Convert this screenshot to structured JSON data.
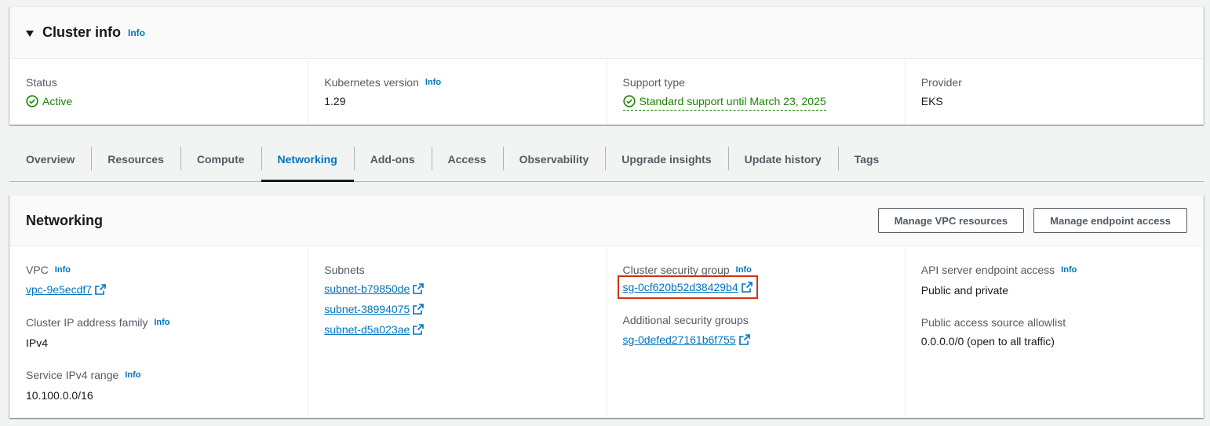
{
  "cluster_info": {
    "title": "Cluster info",
    "info": "Info",
    "status": {
      "label": "Status",
      "value": "Active"
    },
    "kubernetes_version": {
      "label": "Kubernetes version",
      "info": "Info",
      "value": "1.29"
    },
    "support_type": {
      "label": "Support type",
      "value": "Standard support until March 23, 2025"
    },
    "provider": {
      "label": "Provider",
      "value": "EKS"
    }
  },
  "tabs": [
    {
      "label": "Overview"
    },
    {
      "label": "Resources"
    },
    {
      "label": "Compute"
    },
    {
      "label": "Networking",
      "active": true
    },
    {
      "label": "Add-ons"
    },
    {
      "label": "Access"
    },
    {
      "label": "Observability"
    },
    {
      "label": "Upgrade insights"
    },
    {
      "label": "Update history"
    },
    {
      "label": "Tags"
    }
  ],
  "networking": {
    "title": "Networking",
    "buttons": {
      "manage_vpc": "Manage VPC resources",
      "manage_endpoint": "Manage endpoint access"
    },
    "vpc": {
      "label": "VPC",
      "info": "Info",
      "value": "vpc-9e5ecdf7"
    },
    "ip_family": {
      "label": "Cluster IP address family",
      "info": "Info",
      "value": "IPv4"
    },
    "service_range": {
      "label": "Service IPv4 range",
      "info": "Info",
      "value": "10.100.0.0/16"
    },
    "subnets": {
      "label": "Subnets",
      "values": [
        "subnet-b79850de",
        "subnet-38994075",
        "subnet-d5a023ae"
      ]
    },
    "cluster_sg": {
      "label": "Cluster security group",
      "info": "Info",
      "value": "sg-0cf620b52d38429b4"
    },
    "additional_sg": {
      "label": "Additional security groups",
      "value": "sg-0defed27161b6f755"
    },
    "endpoint_access": {
      "label": "API server endpoint access",
      "info": "Info",
      "value": "Public and private"
    },
    "allowlist": {
      "label": "Public access source allowlist",
      "value": "0.0.0.0/0",
      "suffix": " (open to all traffic)"
    }
  },
  "colors": {
    "link": "#0073bb",
    "success": "#1d8102",
    "highlight": "#d13212"
  }
}
